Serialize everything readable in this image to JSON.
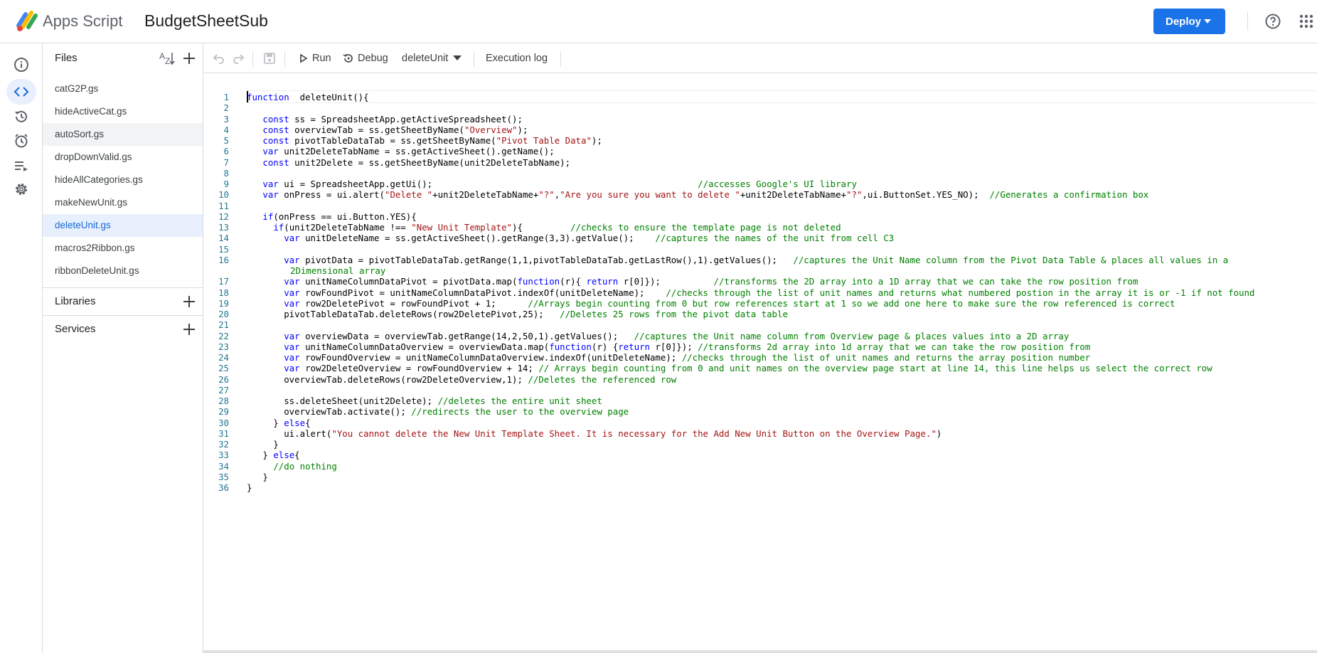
{
  "header": {
    "app_name": "Apps Script",
    "project_name": "BudgetSheetSub",
    "deploy_label": "Deploy",
    "brand_color": "#1a73e8"
  },
  "left_nav": {
    "items": [
      {
        "icon": "info-icon",
        "label": "Overview"
      },
      {
        "icon": "code-icon",
        "label": "Editor",
        "active": true
      },
      {
        "icon": "history-icon",
        "label": "Project History"
      },
      {
        "icon": "alarm-icon",
        "label": "Triggers"
      },
      {
        "icon": "executions-icon",
        "label": "Executions"
      },
      {
        "icon": "gear-icon",
        "label": "Project Settings"
      }
    ]
  },
  "files_panel": {
    "title": "Files",
    "files": [
      {
        "name": "catG2P.gs",
        "state": ""
      },
      {
        "name": "hideActiveCat.gs",
        "state": ""
      },
      {
        "name": "autoSort.gs",
        "state": "hover"
      },
      {
        "name": "dropDownValid.gs",
        "state": ""
      },
      {
        "name": "hideAllCategories.gs",
        "state": ""
      },
      {
        "name": "makeNewUnit.gs",
        "state": ""
      },
      {
        "name": "deleteUnit.gs",
        "state": "selected"
      },
      {
        "name": "macros2Ribbon.gs",
        "state": ""
      },
      {
        "name": "ribbonDeleteUnit.gs",
        "state": ""
      }
    ],
    "libraries_label": "Libraries",
    "services_label": "Services"
  },
  "toolbar": {
    "run_label": "Run",
    "debug_label": "Debug",
    "function_selected": "deleteUnit",
    "execution_log_label": "Execution log"
  },
  "editor": {
    "lines": [
      [
        [
          "kw",
          "function"
        ],
        [
          "",
          "  deleteUnit(){"
        ]
      ],
      [],
      [
        [
          "",
          "   "
        ],
        [
          "kw",
          "const"
        ],
        [
          "",
          " ss = SpreadsheetApp.getActiveSpreadsheet();"
        ]
      ],
      [
        [
          "",
          "   "
        ],
        [
          "kw",
          "const"
        ],
        [
          "",
          " overviewTab = ss.getSheetByName("
        ],
        [
          "str",
          "\"Overview\""
        ],
        [
          "",
          ");"
        ]
      ],
      [
        [
          "",
          "   "
        ],
        [
          "kw",
          "const"
        ],
        [
          "",
          " pivotTableDataTab = ss.getSheetByName("
        ],
        [
          "str",
          "\"Pivot Table Data\""
        ],
        [
          "",
          ");"
        ]
      ],
      [
        [
          "",
          "   "
        ],
        [
          "kw",
          "var"
        ],
        [
          "",
          " unit2DeleteTabName = ss.getActiveSheet().getName();"
        ]
      ],
      [
        [
          "",
          "   "
        ],
        [
          "kw",
          "const"
        ],
        [
          "",
          " unit2Delete = ss.getSheetByName(unit2DeleteTabName);"
        ]
      ],
      [],
      [
        [
          "",
          "   "
        ],
        [
          "kw",
          "var"
        ],
        [
          "",
          " ui = SpreadsheetApp.getUi();                                                  "
        ],
        [
          "cm",
          "//accesses Google's UI library"
        ]
      ],
      [
        [
          "",
          "   "
        ],
        [
          "kw",
          "var"
        ],
        [
          "",
          " onPress = ui.alert("
        ],
        [
          "str",
          "\"Delete \""
        ],
        [
          "",
          "+unit2DeleteTabName+"
        ],
        [
          "str",
          "\"?\""
        ],
        [
          "",
          ","
        ],
        [
          "str",
          "\"Are you sure you want to delete \""
        ],
        [
          "",
          "+unit2DeleteTabName+"
        ],
        [
          "str",
          "\"?\""
        ],
        [
          "",
          ",ui.ButtonSet.YES_NO);  "
        ],
        [
          "cm",
          "//Generates a confirmation box"
        ]
      ],
      [],
      [
        [
          "",
          "   "
        ],
        [
          "kw",
          "if"
        ],
        [
          "",
          "(onPress == ui.Button.YES){"
        ]
      ],
      [
        [
          "",
          "     "
        ],
        [
          "kw",
          "if"
        ],
        [
          "",
          "(unit2DeleteTabName !== "
        ],
        [
          "str",
          "\"New Unit Template\""
        ],
        [
          "",
          "){         "
        ],
        [
          "cm",
          "//checks to ensure the template page is not deleted"
        ]
      ],
      [
        [
          "",
          "       "
        ],
        [
          "kw",
          "var"
        ],
        [
          "",
          " unitDeleteName = ss.getActiveSheet().getRange(3,3).getValue();    "
        ],
        [
          "cm",
          "//captures the names of the unit from cell C3"
        ]
      ],
      [],
      [
        [
          "",
          "       "
        ],
        [
          "kw",
          "var"
        ],
        [
          "",
          " pivotData = pivotTableDataTab.getRange(1,1,pivotTableDataTab.getLastRow(),1).getValues();   "
        ],
        [
          "cm",
          "//captures the Unit Name column from the Pivot Data Table & places all values in a"
        ]
      ],
      [
        [
          "",
          "       "
        ],
        [
          "kw",
          "var"
        ],
        [
          "",
          " unitNameColumnDataPivot = pivotData.map("
        ],
        [
          "kw",
          "function"
        ],
        [
          "",
          "(r){ "
        ],
        [
          "kw",
          "return"
        ],
        [
          "",
          " r[0]});          "
        ],
        [
          "cm",
          "//transforms the 2D array into a 1D array that we can take the row position from"
        ]
      ],
      [
        [
          "",
          "       "
        ],
        [
          "kw",
          "var"
        ],
        [
          "",
          " rowFoundPivot = unitNameColumnDataPivot.indexOf(unitDeleteName);    "
        ],
        [
          "cm",
          "//checks through the list of unit names and returns what numbered postion in the array it is or -1 if not found"
        ]
      ],
      [
        [
          "",
          "       "
        ],
        [
          "kw",
          "var"
        ],
        [
          "",
          " row2DeletePivot = rowFoundPivot + 1;      "
        ],
        [
          "cm",
          "//Arrays begin counting from 0 but row references start at 1 so we add one here to make sure the row referenced is correct"
        ]
      ],
      [
        [
          "",
          "       pivotTableDataTab.deleteRows(row2DeletePivot,25);   "
        ],
        [
          "cm",
          "//Deletes 25 rows from the pivot data table"
        ]
      ],
      [],
      [
        [
          "",
          "       "
        ],
        [
          "kw",
          "var"
        ],
        [
          "",
          " overviewData = overviewTab.getRange(14,2,50,1).getValues();   "
        ],
        [
          "cm",
          "//captures the Unit name column from Overview page & places values into a 2D array"
        ]
      ],
      [
        [
          "",
          "       "
        ],
        [
          "kw",
          "var"
        ],
        [
          "",
          " unitNameColumnDataOverview = overviewData.map("
        ],
        [
          "kw",
          "function"
        ],
        [
          "",
          "(r) {"
        ],
        [
          "kw",
          "return"
        ],
        [
          "",
          " r[0]}); "
        ],
        [
          "cm",
          "//transforms 2d array into 1d array that we can take the row position from"
        ]
      ],
      [
        [
          "",
          "       "
        ],
        [
          "kw",
          "var"
        ],
        [
          "",
          " rowFoundOverview = unitNameColumnDataOverview.indexOf(unitDeleteName); "
        ],
        [
          "cm",
          "//checks through the list of unit names and returns the array position number"
        ]
      ],
      [
        [
          "",
          "       "
        ],
        [
          "kw",
          "var"
        ],
        [
          "",
          " row2DeleteOverview = rowFoundOverview + 14; "
        ],
        [
          "cm",
          "// Arrays begin counting from 0 and unit names on the overview page start at line 14, this line helps us select the correct row"
        ]
      ],
      [
        [
          "",
          "       overviewTab.deleteRows(row2DeleteOverview,1); "
        ],
        [
          "cm",
          "//Deletes the referenced row"
        ]
      ],
      [],
      [
        [
          "",
          "       ss.deleteSheet(unit2Delete); "
        ],
        [
          "cm",
          "//deletes the entire unit sheet"
        ]
      ],
      [
        [
          "",
          "       overviewTab.activate(); "
        ],
        [
          "cm",
          "//redirects the user to the overview page"
        ]
      ],
      [
        [
          "",
          "     } "
        ],
        [
          "kw",
          "else"
        ],
        [
          "",
          "{"
        ]
      ],
      [
        [
          "",
          "       ui.alert("
        ],
        [
          "str",
          "\"You cannot delete the New Unit Template Sheet. It is necessary for the Add New Unit Button on the Overview Page.\""
        ],
        [
          "",
          ")"
        ]
      ],
      [
        [
          "",
          "     }"
        ]
      ],
      [
        [
          "",
          "   } "
        ],
        [
          "kw",
          "else"
        ],
        [
          "",
          "{"
        ]
      ],
      [
        [
          "",
          "     "
        ],
        [
          "cm",
          "//do nothing"
        ]
      ],
      [
        [
          "",
          "   }"
        ]
      ],
      [
        [
          "",
          "}"
        ]
      ]
    ],
    "line_16_wrap": "2Dimensional array",
    "colors": {
      "keyword": "#0000ff",
      "string": "#a31515",
      "comment": "#008000",
      "line_number": "#237893"
    }
  }
}
